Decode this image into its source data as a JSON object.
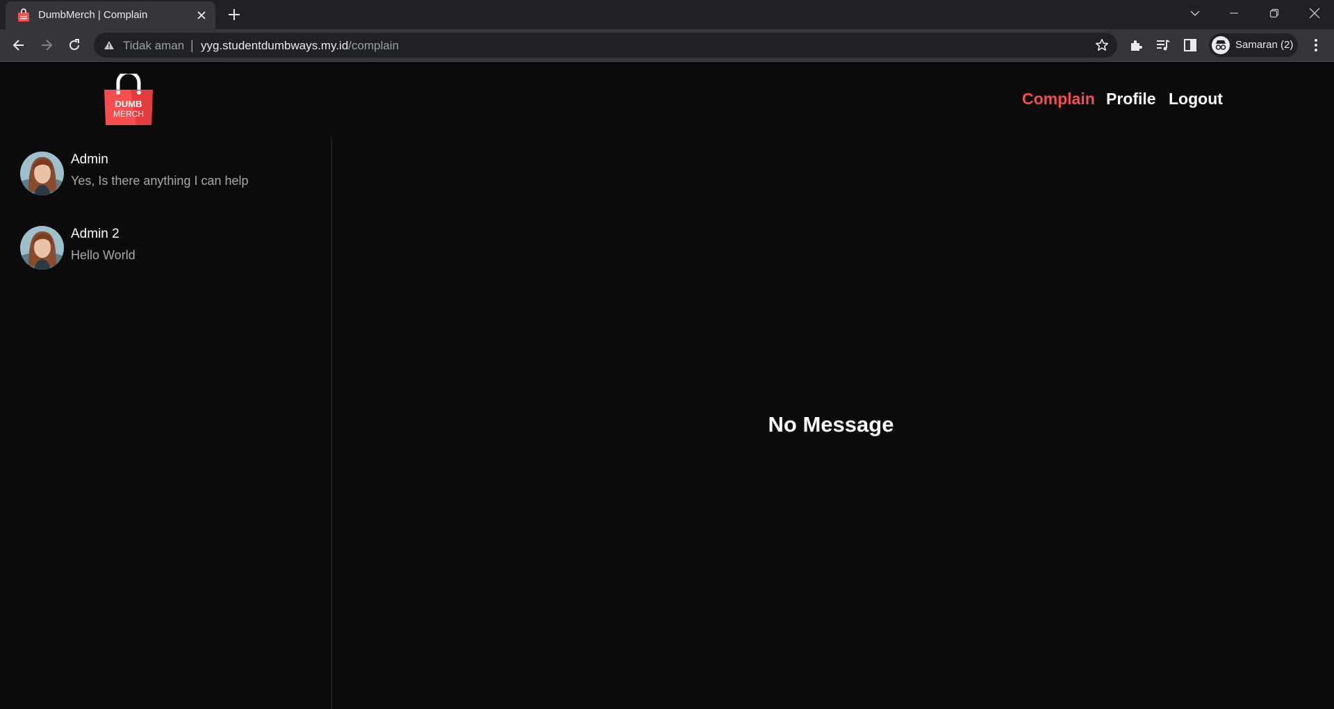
{
  "browser": {
    "tab_title": "DumbMerch | Complain",
    "omnibox": {
      "security_label": "Tidak aman",
      "separator": "|",
      "domain": "yyg.studentdumbways.my.id",
      "path": "/complain"
    },
    "profile_label": "Samaran (2)",
    "icons": [
      "tab-favicon",
      "tab-close-icon",
      "new-tab-icon",
      "tab-search-icon",
      "minimize-icon",
      "restore-icon",
      "window-close-icon",
      "back-icon",
      "forward-icon",
      "reload-icon",
      "warning-icon",
      "star-icon",
      "extensions-icon",
      "media-icon",
      "side-panel-icon",
      "incognito-icon",
      "more-menu-icon"
    ]
  },
  "header": {
    "logo_text_line1": "DUMB",
    "logo_text_line2": "MERCH",
    "nav": [
      {
        "label": "Complain",
        "active": true
      },
      {
        "label": "Profile",
        "active": false
      },
      {
        "label": "Logout",
        "active": false
      }
    ]
  },
  "contacts": [
    {
      "name": "Admin",
      "last_message": "Yes, Is there anything I can help"
    },
    {
      "name": "Admin 2",
      "last_message": "Hello World"
    }
  ],
  "chat": {
    "empty_text": "No Message"
  },
  "colors": {
    "brand_red": "#f74d4d",
    "page_bg": "#0b0b0c",
    "chrome_bg": "#202124",
    "toolbar_bg": "#35363a"
  }
}
